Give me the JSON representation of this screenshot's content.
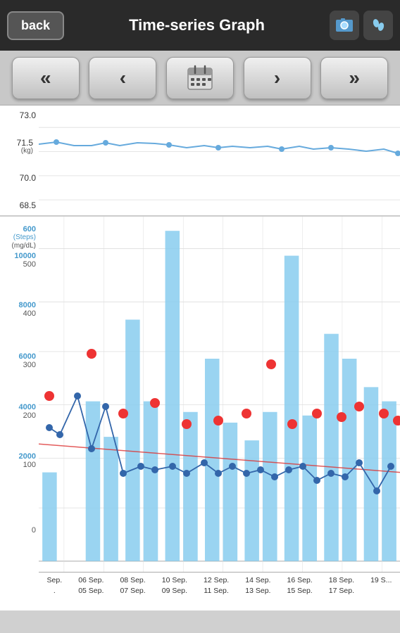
{
  "header": {
    "back_label": "back",
    "title": "Time-series Graph",
    "icon_camera": "📷",
    "icon_walk": "🦶"
  },
  "nav": {
    "fast_prev": "«",
    "prev": "‹",
    "calendar": "📅",
    "next": "›",
    "fast_next": "»"
  },
  "weight_chart": {
    "unit": "(kg)",
    "labels": [
      "73.0",
      "71.5",
      "70.0",
      "68.5"
    ]
  },
  "steps_chart": {
    "left_labels_blue": [
      "600",
      "(Steps)",
      "(mg/dL)",
      "10000",
      "",
      "8000",
      "",
      "6000",
      "",
      "4000",
      "",
      "2000"
    ],
    "left_labels_black": [
      "",
      "",
      "",
      "500",
      "",
      "400",
      "",
      "300",
      "",
      "200",
      "",
      "100",
      "0"
    ],
    "x_labels": [
      {
        "top": "Sep.",
        "bot": "."
      },
      {
        "top": "06 Sep.",
        "bot": "05 Sep."
      },
      {
        "top": "08 Sep.",
        "bot": "07 Sep."
      },
      {
        "top": "10 Sep.",
        "bot": "09 Sep."
      },
      {
        "top": "12 Sep.",
        "bot": "11 Sep."
      },
      {
        "top": "14 Sep.",
        "bot": "13 Sep."
      },
      {
        "top": "16 Sep.",
        "bot": "15 Sep."
      },
      {
        "top": "18 Sep.",
        "bot": "17 Sep."
      },
      {
        "top": "",
        "bot": "19 S..."
      }
    ]
  }
}
